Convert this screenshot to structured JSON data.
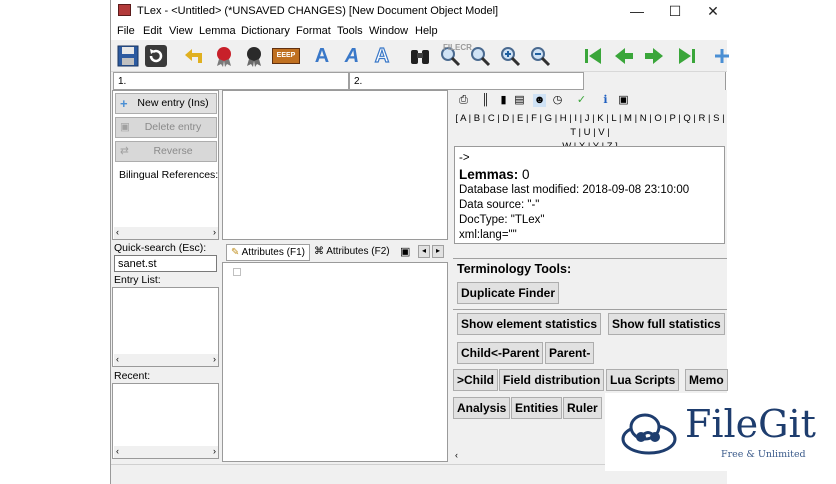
{
  "window": {
    "title": "TLex - <Untitled> (*UNSAVED CHANGES) [New Document Object Model]",
    "minimize": "—",
    "maximize": "☐",
    "close": "✕"
  },
  "menu": [
    "File",
    "Edit",
    "View",
    "Lemma",
    "Dictionary",
    "Format",
    "Tools",
    "Window",
    "Help"
  ],
  "toolbar": {
    "icons": [
      "save-icon",
      "refresh-icon",
      "undo-icon",
      "red-stamp-icon",
      "black-stamp-icon",
      "eeep-icon",
      "font-bold-icon",
      "font-italic-icon",
      "font-outline-icon",
      "binoculars-icon",
      "search-icon",
      "zoom-in-icon",
      "zoom-out-icon",
      "first-icon",
      "prev-icon",
      "next-icon",
      "last-icon",
      "add-icon"
    ],
    "eeep_label": "EEEP",
    "watermark_overlay": "FILECR"
  },
  "tabs": {
    "tab1": "1.",
    "tab2": "2."
  },
  "left": {
    "new_entry": "New entry (Ins)",
    "delete_entry": "Delete entry",
    "reverse": "Reverse",
    "bilingual_refs": "Bilingual References:",
    "quick_search_label": "Quick-search (Esc):",
    "quick_search_value": "sanet.st",
    "entry_list_label": "Entry List:",
    "recent_label": "Recent:"
  },
  "middle": {
    "attr_tab1": "Attributes (F1)",
    "attr_tab2": "Attributes (F2)"
  },
  "right": {
    "alphabet_line1": "[ A | B | C | D | E | F | G | H | I | J | K | L | M | N | O | P | Q | R | S | T | U | V |",
    "alphabet_line2": "W | X | Y | Z ]",
    "info_arrow": "->",
    "lemmas_label": "Lemmas:",
    "lemmas_value": "0",
    "db_modified": "Database last modified: 2018-09-08 23:10:00",
    "data_source": "Data source: \"-\"",
    "doctype": "DocType: \"TLex\"",
    "xml_lang": "xml:lang=\"\"",
    "terminology_title": "Terminology Tools:",
    "duplicate_finder": "Duplicate Finder",
    "show_element_stats": "Show element statistics",
    "show_full_stats": "Show full statistics",
    "child_parent": "Child<-Parent",
    "parent": "Parent-",
    "child": ">Child",
    "field_distribution": "Field distribution",
    "lua_scripts": "Lua Scripts",
    "memo": "Memo",
    "analysis": "Analysis",
    "entities": "Entities",
    "ruler": "Ruler"
  },
  "branding": {
    "name": "FileGit",
    "tagline": "Free & Unlimited"
  },
  "colors": {
    "accent_blue": "#4a8fd4",
    "nav_green": "#3aa63a",
    "brand_navy": "#1e3d6e"
  }
}
